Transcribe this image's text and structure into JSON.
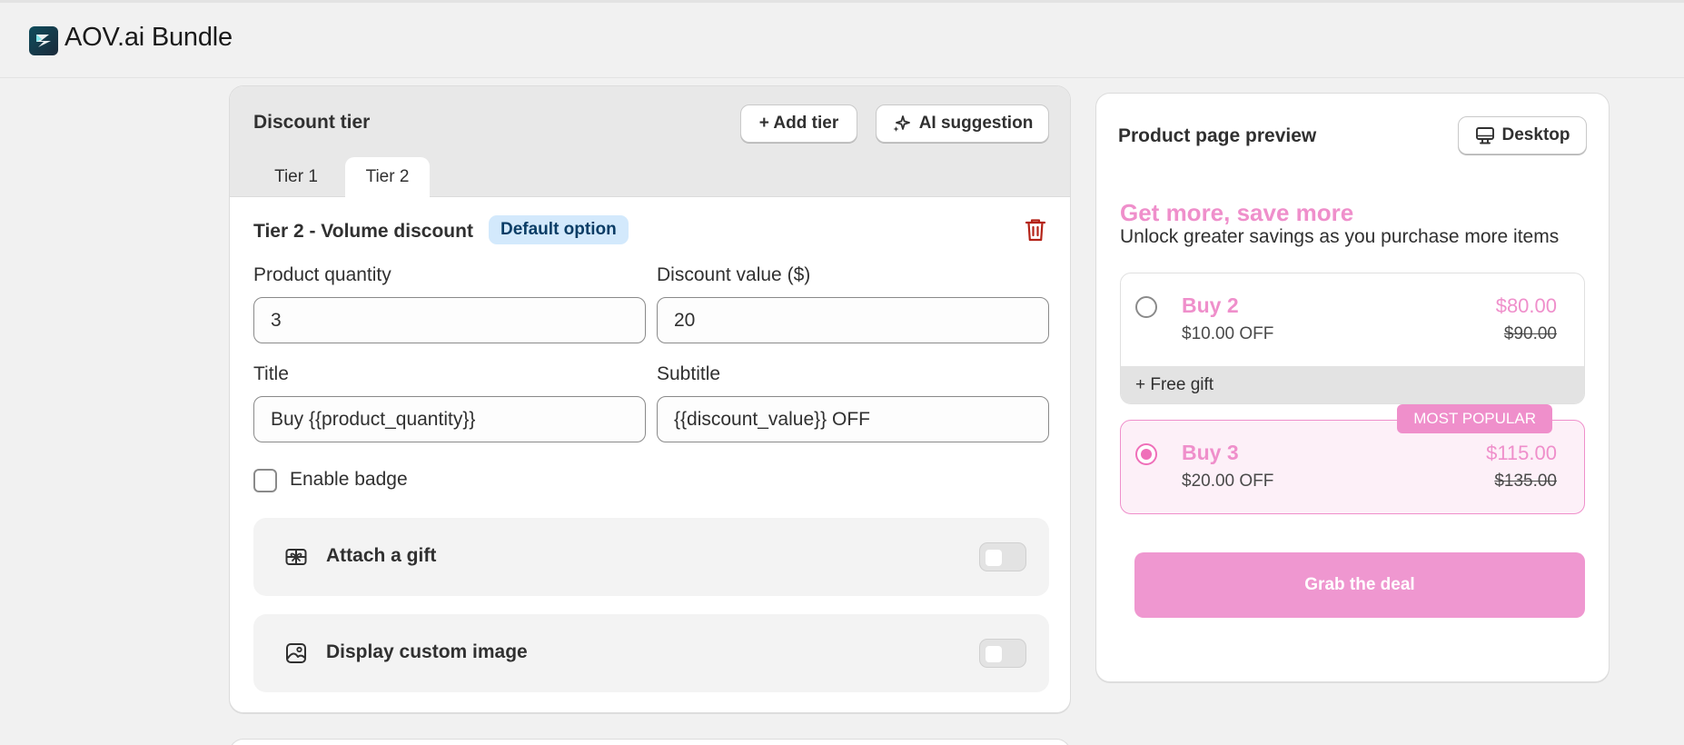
{
  "app": {
    "title": "AOV.ai Bundle"
  },
  "discount_tier": {
    "section_title": "Discount tier",
    "add_tier_label": "+ Add tier",
    "ai_suggestion_label": "AI suggestion",
    "tabs": [
      {
        "label": "Tier 1",
        "selected": false
      },
      {
        "label": "Tier 2",
        "selected": true
      }
    ],
    "tier_title": "Tier 2 - Volume discount",
    "default_badge": "Default option",
    "fields": {
      "product_quantity": {
        "label": "Product quantity",
        "value": "3"
      },
      "discount_value": {
        "label": "Discount value ($)",
        "value": "20"
      },
      "title": {
        "label": "Title",
        "value": "Buy {{product_quantity}}"
      },
      "subtitle": {
        "label": "Subtitle",
        "value": "{{discount_value}} OFF"
      }
    },
    "enable_badge": {
      "label": "Enable badge",
      "checked": false
    },
    "options": [
      {
        "label": "Attach a gift",
        "icon": "gift-icon",
        "enabled": false
      },
      {
        "label": "Display custom image",
        "icon": "image-icon",
        "enabled": false
      }
    ]
  },
  "preview": {
    "title": "Product page preview",
    "device_label": "Desktop",
    "heading": "Get more, save more",
    "subheading": "Unlock greater savings as you purchase more items",
    "offers": [
      {
        "title": "Buy 2",
        "subtitle": "$10.00 OFF",
        "price": "$80.00",
        "old_price": "$90.00",
        "extra": "+ Free gift",
        "selected": false
      },
      {
        "title": "Buy 3",
        "subtitle": "$20.00 OFF",
        "price": "$115.00",
        "old_price": "$135.00",
        "badge": "MOST POPULAR",
        "selected": true
      }
    ],
    "cta_label": "Grab the deal"
  },
  "colors": {
    "accent_pink": "#ef8fcb",
    "cta_pink": "#ef97d0",
    "default_badge_bg": "#d3e9fc",
    "trash_red": "#b42318"
  }
}
